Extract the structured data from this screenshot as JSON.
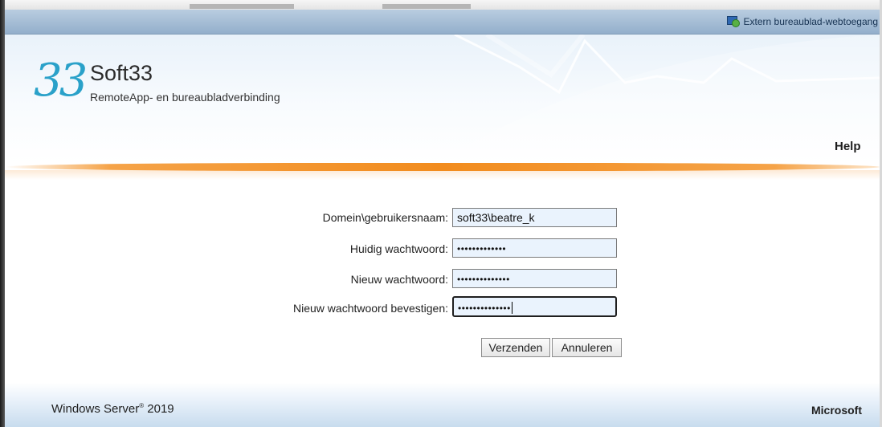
{
  "titlebar": {
    "title": "Extern bureaublad-webtoegang",
    "icon": "remote-desktop-icon"
  },
  "header": {
    "logo_mark": "33",
    "company": "Soft33",
    "subtitle": "RemoteApp- en bureaubladverbinding",
    "help_label": "Help"
  },
  "form": {
    "fields": [
      {
        "label": "Domein\\gebruikersnaam:",
        "value": "soft33\\beatre_k",
        "type": "text"
      },
      {
        "label": "Huidig wachtwoord:",
        "value": "•••••••••••••",
        "type": "password"
      },
      {
        "label": "Nieuw wachtwoord:",
        "value": "••••••••••••••",
        "type": "password"
      },
      {
        "label": "Nieuw wachtwoord bevestigen:",
        "value": "••••••••••••••",
        "type": "password",
        "focused": true
      }
    ],
    "submit_label": "Verzenden",
    "cancel_label": "Annuleren"
  },
  "footer": {
    "product": "Windows Server",
    "product_mark": "®",
    "product_version": "2019",
    "brand": "Microsoft"
  },
  "colors": {
    "accent_orange": "#f28c1e",
    "titlebar_blue": "#93afcb",
    "field_background": "#eaf3fd",
    "logo_blue": "#2aa1c9"
  }
}
